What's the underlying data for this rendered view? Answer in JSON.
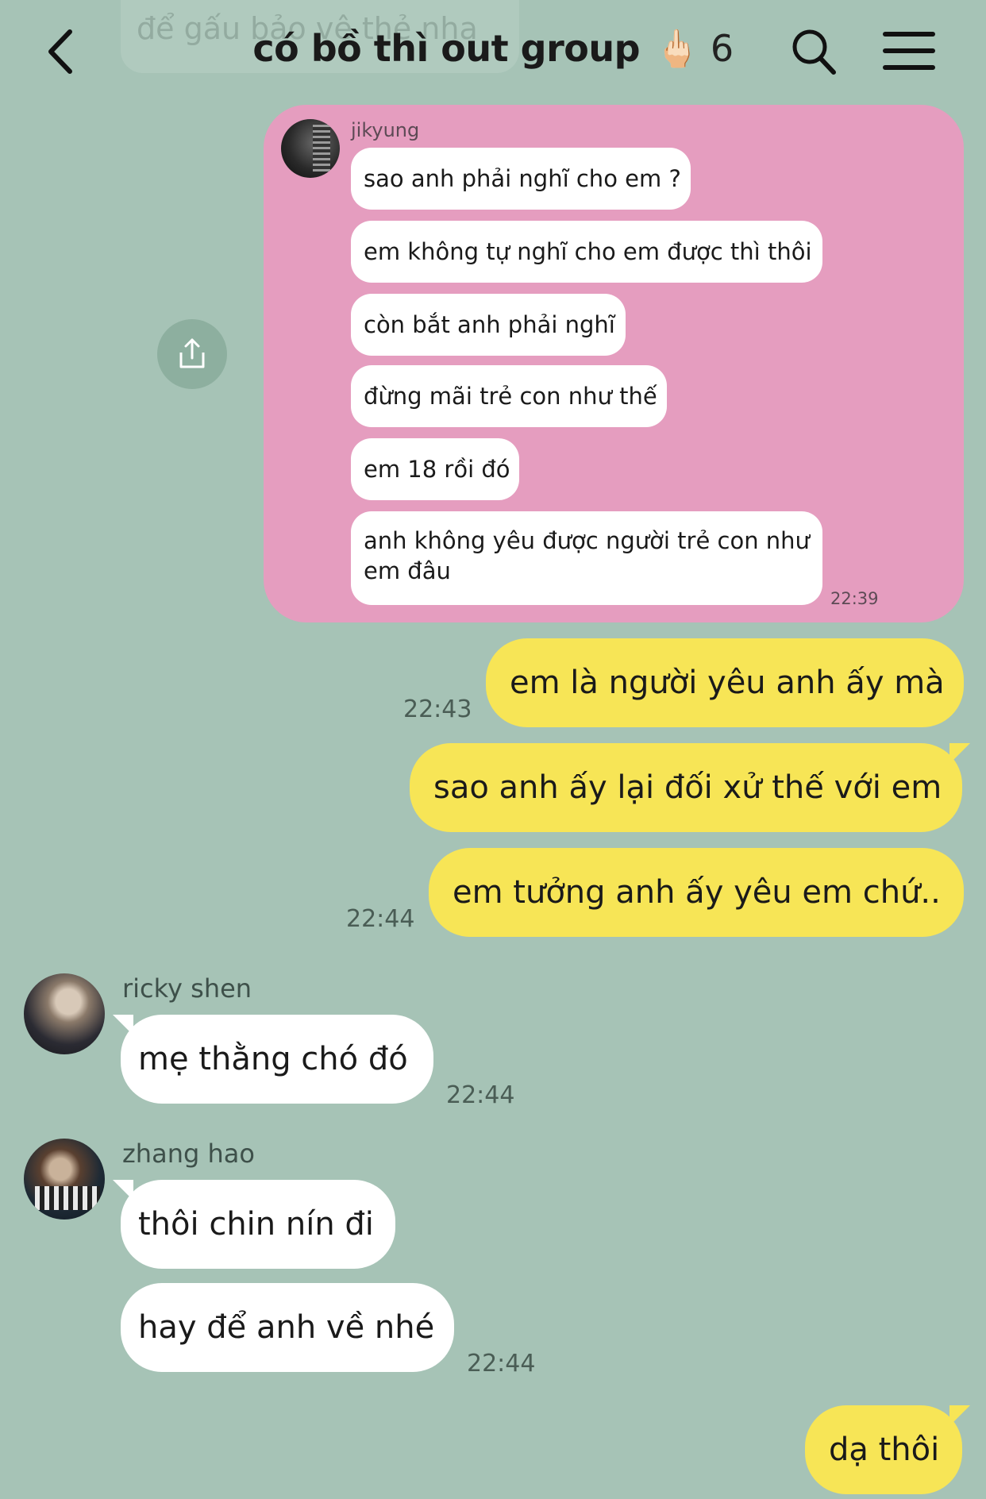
{
  "header": {
    "ghost_text": "để gấu bảo vệ thẻ nha",
    "title": "có bồ thì out group",
    "title_emoji": "🖕🏻",
    "member_count": "6"
  },
  "shared_screenshot": {
    "sender": "jikyung",
    "messages": [
      "sao anh phải nghĩ cho em ?",
      "em không tự nghĩ cho em được thì thôi",
      "còn bắt anh phải nghĩ",
      "đừng mãi trẻ con như thế",
      "em 18 rồi đó",
      "anh không yêu được người trẻ con như em đâu"
    ],
    "time": "22:39"
  },
  "my_messages": [
    {
      "text": "em là người yêu anh ấy mà",
      "time": "22:43"
    },
    {
      "text": "sao anh ấy lại đối xử thế với em"
    },
    {
      "text": "em tưởng anh ấy yêu em chứ..",
      "time": "22:44"
    }
  ],
  "ricky": {
    "name": "ricky shen",
    "message": "mẹ thằng chó đó",
    "time": "22:44"
  },
  "zhang": {
    "name": "zhang hao",
    "messages": [
      "thôi chin nín đi",
      "hay để anh về nhé"
    ],
    "time": "22:44"
  },
  "last_message": {
    "text": "dạ thôi"
  },
  "colors": {
    "background": "#a6c3b6",
    "my_bubble": "#f7e556",
    "other_bubble": "#ffffff",
    "shared_card": "#e59dbf"
  },
  "icons": [
    "back-chevron-icon",
    "search-icon",
    "menu-icon",
    "share-icon"
  ]
}
